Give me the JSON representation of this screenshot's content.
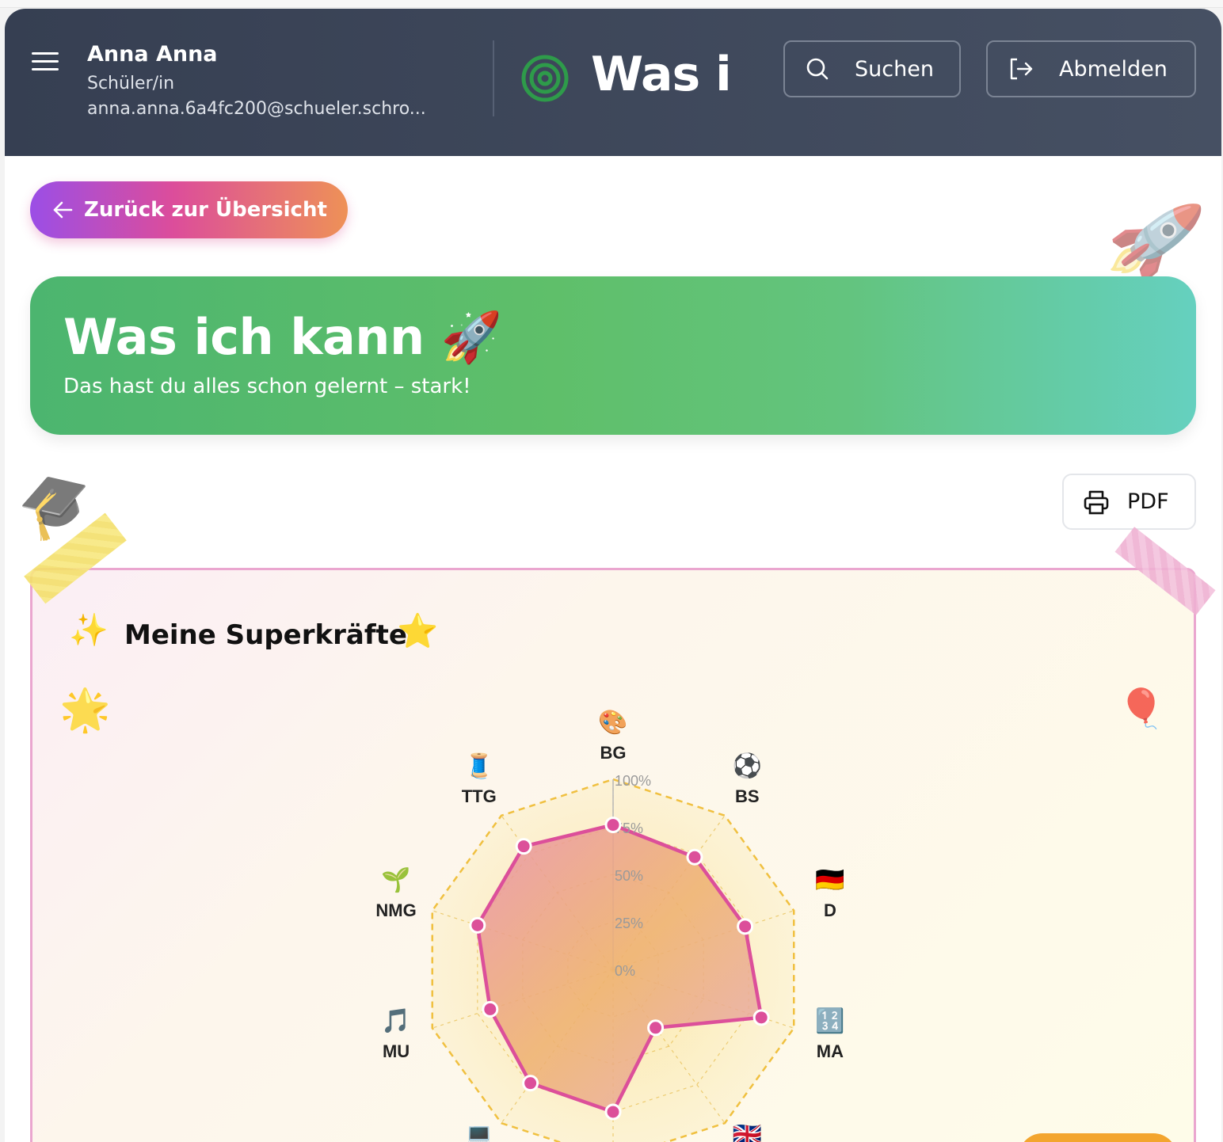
{
  "header": {
    "user_name": "Anna Anna",
    "user_role": "Schüler/in",
    "user_email": "anna.anna.6a4fc200@schueler.schro...",
    "app_title": "Was i",
    "search_label": "Suchen",
    "logout_label": "Abmelden",
    "menu_icon": "menu-icon",
    "logo_icon": "target-icon"
  },
  "back_button": {
    "label": "Zurück zur Übersicht"
  },
  "hero": {
    "title": "Was ich kann 🚀",
    "subtitle": "Das hast du alles schon gelernt – stark!"
  },
  "pdf_button": {
    "label": "PDF"
  },
  "card": {
    "title": "Meine Superkräfte",
    "title_emoji_left": "✨",
    "title_emoji_right": "⭐"
  },
  "decorations": {
    "rocket": "🚀",
    "grad_cap": "🎓",
    "star": "🌟",
    "balloon": "🎈"
  },
  "colors": {
    "header_bg": "#3b4456",
    "hero_start": "#4cb56f",
    "hero_end": "#65d0bf",
    "accent_pink": "#e0509a",
    "grid_gold": "#f0c040"
  },
  "chart_data": {
    "type": "radar",
    "scale_labels": [
      "0%",
      "25%",
      "50%",
      "75%",
      "100%"
    ],
    "axes": [
      {
        "label": "BG",
        "emoji": "🎨",
        "value": 76
      },
      {
        "label": "BS",
        "emoji": "⚽",
        "value": 73
      },
      {
        "label": "D",
        "emoji": "🇩🇪",
        "value": 73
      },
      {
        "label": "MA",
        "emoji": "🔢",
        "value": 82
      },
      {
        "label": "",
        "emoji": "🇬🇧",
        "value": 38
      },
      {
        "label": "",
        "emoji": "",
        "value": 75
      },
      {
        "label": "",
        "emoji": "💻",
        "value": 74
      },
      {
        "label": "MU",
        "emoji": "🎵",
        "value": 68
      },
      {
        "label": "NMG",
        "emoji": "🌱",
        "value": 75
      },
      {
        "label": "TTG",
        "emoji": "🧵",
        "value": 80
      }
    ]
  }
}
